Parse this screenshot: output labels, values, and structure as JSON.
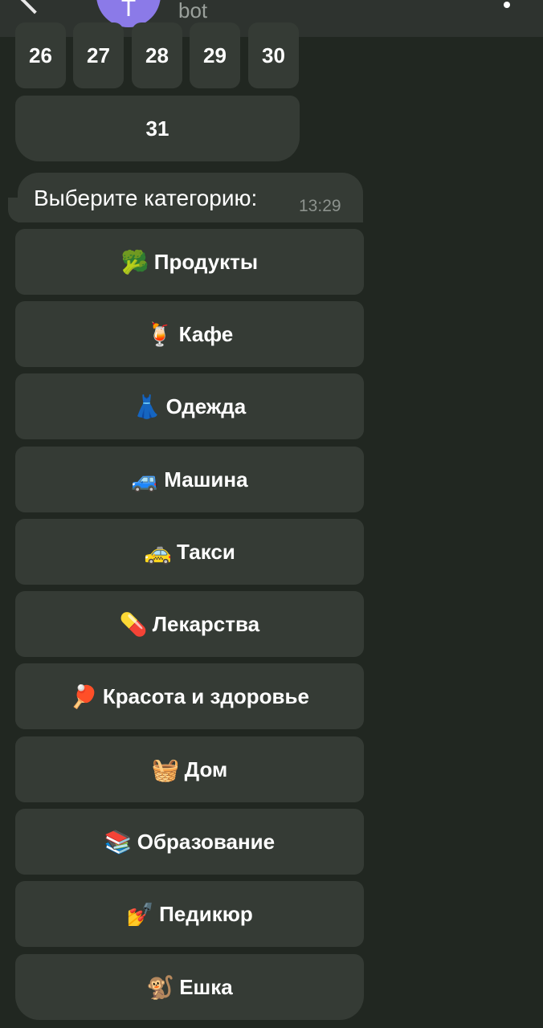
{
  "header": {
    "avatar_letter": "Т",
    "subtitle": "bot"
  },
  "days": [
    "26",
    "27",
    "28",
    "29",
    "30",
    "31"
  ],
  "message": {
    "text": "Выберите категорию:",
    "time": "13:29"
  },
  "categories": [
    {
      "icon": "broccoli-icon",
      "emoji": "🥦",
      "label": "Продукты"
    },
    {
      "icon": "tropical-drink-icon",
      "emoji": "🍹",
      "label": "Кафе"
    },
    {
      "icon": "dress-icon",
      "emoji": "👗",
      "label": "Одежда"
    },
    {
      "icon": "car-icon",
      "emoji": "🚙",
      "label": "Машина"
    },
    {
      "icon": "taxi-icon",
      "emoji": "🚕",
      "label": "Такси"
    },
    {
      "icon": "pill-icon",
      "emoji": "💊",
      "label": "Лекарства"
    },
    {
      "icon": "ping-pong-icon",
      "emoji": "🏓",
      "label": "Красота и здоровье"
    },
    {
      "icon": "basket-icon",
      "emoji": "🧺",
      "label": "Дом"
    },
    {
      "icon": "books-icon",
      "emoji": "📚",
      "label": "Образование"
    },
    {
      "icon": "nail-polish-icon",
      "emoji": "💅",
      "label": "Педикюр"
    },
    {
      "icon": "monkey-icon",
      "emoji": "🐒",
      "label": "Ешка"
    }
  ],
  "colors": {
    "background": "#212721",
    "button": "#353b35",
    "header": "#2e332f",
    "avatar": "#8b7ae8"
  }
}
